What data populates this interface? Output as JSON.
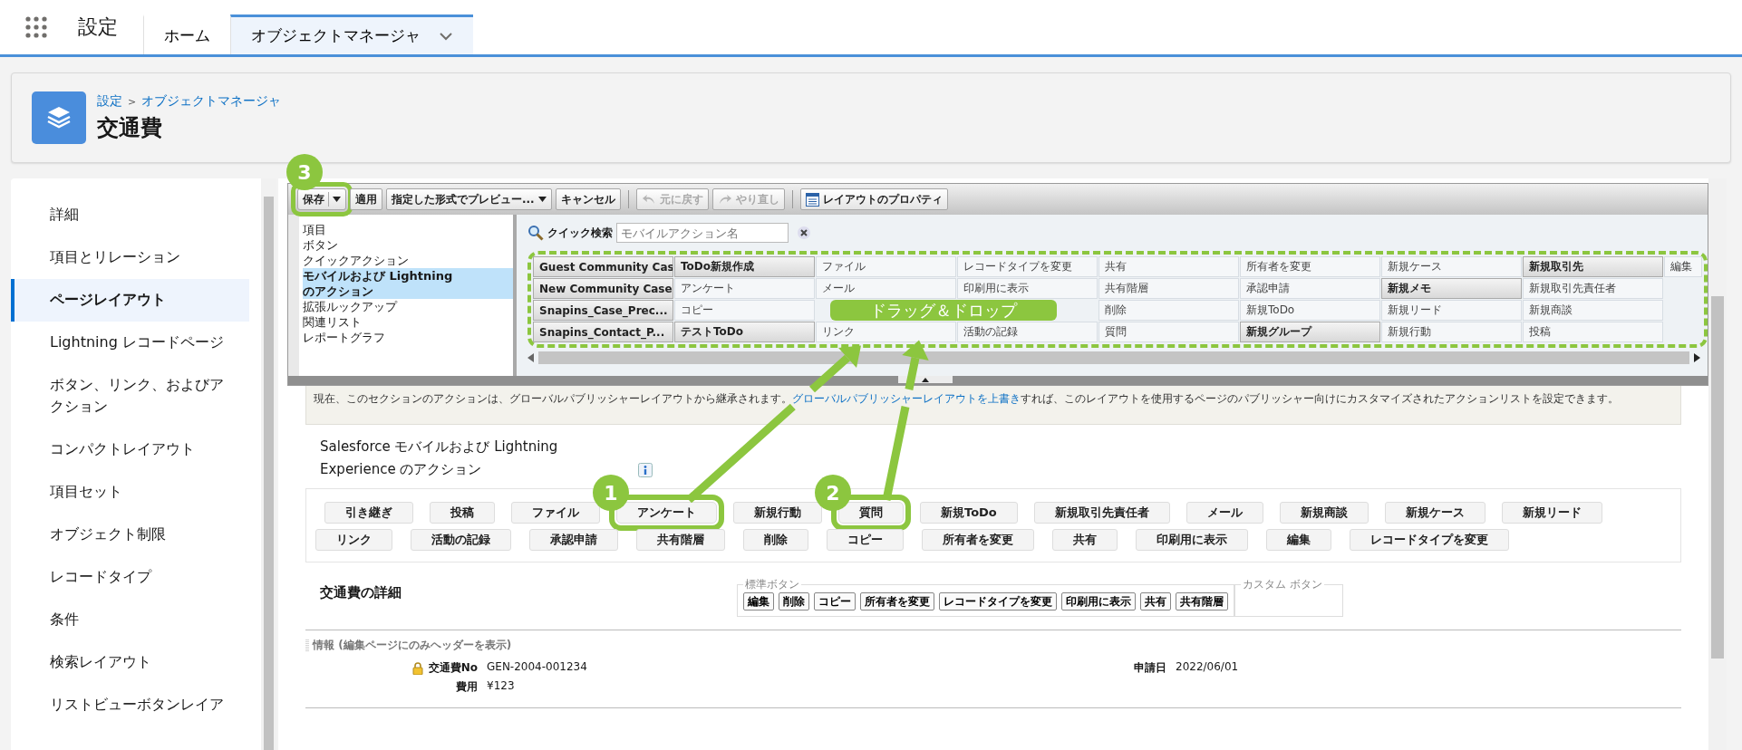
{
  "app_bar": {
    "title": "設定",
    "tabs": [
      {
        "label": "ホーム",
        "selected": false,
        "dropdown": false
      },
      {
        "label": "オブジェクトマネージャ",
        "selected": true,
        "dropdown": true
      }
    ]
  },
  "header": {
    "breadcrumb": [
      "設定",
      "オブジェクトマネージャ"
    ],
    "separator": ">",
    "title": "交通費"
  },
  "sidebar": {
    "items": [
      {
        "label": "詳細",
        "selected": false
      },
      {
        "label": "項目とリレーション",
        "selected": false
      },
      {
        "label": "ページレイアウト",
        "selected": true
      },
      {
        "label": "Lightning レコードページ",
        "selected": false
      },
      {
        "label": "ボタン、リンク、およびアクション",
        "selected": false
      },
      {
        "label": "コンパクトレイアウト",
        "selected": false
      },
      {
        "label": "項目セット",
        "selected": false
      },
      {
        "label": "オブジェクト制限",
        "selected": false
      },
      {
        "label": "レコードタイプ",
        "selected": false
      },
      {
        "label": "条件",
        "selected": false
      },
      {
        "label": "検索レイアウト",
        "selected": false
      },
      {
        "label": "リストビューボタンレイア",
        "selected": false
      }
    ]
  },
  "toolbar": {
    "groups": [
      {
        "buttons": [
          {
            "label": "保存",
            "kind": "split",
            "disabled": false,
            "callout": "3"
          },
          {
            "label": "適用",
            "kind": "plain",
            "disabled": false
          },
          {
            "label": "指定した形式でプレビュー...",
            "kind": "menu",
            "disabled": false
          },
          {
            "label": "キャンセル",
            "kind": "plain",
            "disabled": false
          }
        ]
      },
      {
        "buttons": [
          {
            "label": "元に戻す",
            "kind": "undo",
            "disabled": true
          },
          {
            "label": "やり直し",
            "kind": "redo",
            "disabled": true
          }
        ]
      },
      {
        "buttons": [
          {
            "label": "レイアウトのプロパティ",
            "kind": "properties",
            "disabled": false
          }
        ]
      }
    ]
  },
  "palette": {
    "categories": [
      {
        "label": "項目",
        "selected": false
      },
      {
        "label": "ボタン",
        "selected": false
      },
      {
        "label": "クイックアクション",
        "selected": false
      },
      {
        "label": "モバイルおよび Lightning のアクション",
        "selected": true
      },
      {
        "label": "拡張ルックアップ",
        "selected": false
      },
      {
        "label": "関連リスト",
        "selected": false
      },
      {
        "label": "レポートグラフ",
        "selected": false
      }
    ],
    "search": {
      "label": "クイック検索",
      "placeholder": "モバイルアクション名"
    },
    "grid": [
      [
        {
          "label": "Guest Community Cas",
          "highlighted": true
        },
        {
          "label": "ToDo新規作成",
          "highlighted": true
        },
        {
          "label": "ファイル",
          "highlighted": false
        },
        {
          "label": "レコードタイプを変更",
          "highlighted": false
        },
        {
          "label": "共有",
          "highlighted": false
        },
        {
          "label": "所有者を変更",
          "highlighted": false
        },
        {
          "label": "新規ケース",
          "highlighted": false
        },
        {
          "label": "新規取引先",
          "highlighted": true
        },
        {
          "label": "編集",
          "highlighted": false
        }
      ],
      [
        {
          "label": "New Community Case",
          "highlighted": true
        },
        {
          "label": "アンケート",
          "highlighted": false
        },
        {
          "label": "メール",
          "highlighted": false
        },
        {
          "label": "印刷用に表示",
          "highlighted": false
        },
        {
          "label": "共有階層",
          "highlighted": false
        },
        {
          "label": "承認申請",
          "highlighted": false
        },
        {
          "label": "新規メモ",
          "highlighted": true
        },
        {
          "label": "新規取引先責任者",
          "highlighted": false
        }
      ],
      [
        {
          "label": "Snapins_Case_Prec...",
          "highlighted": true
        },
        {
          "label": "コピー",
          "highlighted": false
        },
        {
          "kind": "covered"
        },
        {
          "kind": "covered"
        },
        {
          "label": "削除",
          "highlighted": false
        },
        {
          "label": "新規ToDo",
          "highlighted": false
        },
        {
          "label": "新規リード",
          "highlighted": false
        },
        {
          "label": "新規商談",
          "highlighted": false
        }
      ],
      [
        {
          "label": "Snapins_Contact_P...",
          "highlighted": true
        },
        {
          "label": "テストToDo",
          "highlighted": true
        },
        {
          "label": "リンク",
          "highlighted": false
        },
        {
          "label": "活動の記録",
          "highlighted": false
        },
        {
          "label": "質問",
          "highlighted": false
        },
        {
          "label": "新規グループ",
          "highlighted": true
        },
        {
          "label": "新規行動",
          "highlighted": false
        },
        {
          "label": "投稿",
          "highlighted": false
        }
      ]
    ],
    "drag_label": "ドラッグ＆ドロップ"
  },
  "notice": {
    "before": "現在、このセクションのアクションは、グローバルパブリッシャーレイアウトから継承されます。",
    "link": "グローバルパブリッシャーレイアウトを上書き",
    "after": "すれば、このレイアウトを使用するページのパブリッシャー向けにカスタマイズされたアクションリストを設定できます。"
  },
  "actions_section": {
    "title": "Salesforce モバイルおよび Lightning Experience のアクション",
    "rows": [
      [
        {
          "label": "引き継ぎ"
        },
        {
          "label": "投稿"
        },
        {
          "label": "ファイル"
        },
        {
          "label": "アンケート",
          "callout": "1"
        },
        {
          "label": "新規行動"
        },
        {
          "label": "質問",
          "callout": "2"
        },
        {
          "label": "新規ToDo"
        },
        {
          "label": "新規取引先責任者"
        },
        {
          "label": "メール"
        },
        {
          "label": "新規商談"
        },
        {
          "label": "新規ケース"
        },
        {
          "label": "新規リード"
        }
      ],
      [
        {
          "label": "リンク"
        },
        {
          "label": "活動の記録"
        },
        {
          "label": "承認申請"
        },
        {
          "label": "共有階層"
        },
        {
          "label": "削除"
        },
        {
          "label": "コピー"
        },
        {
          "label": "所有者を変更"
        },
        {
          "label": "共有"
        },
        {
          "label": "印刷用に表示"
        },
        {
          "label": "編集"
        },
        {
          "label": "レコードタイプを変更"
        }
      ]
    ]
  },
  "detail": {
    "title": "交通費の詳細",
    "standard_buttons": {
      "legend": "標準ボタン",
      "buttons": [
        "編集",
        "削除",
        "コピー",
        "所有者を変更",
        "レコードタイプを変更",
        "印刷用に表示",
        "共有",
        "共有階層"
      ]
    },
    "custom_buttons": {
      "legend": "カスタム ボタン"
    }
  },
  "info_section": {
    "title": "情報 (編集ページにのみヘッダーを表示)",
    "columns": [
      {
        "fields": [
          {
            "label": "交通費No",
            "value": "GEN-2004-001234",
            "locked": true
          },
          {
            "label": "費用",
            "value": "¥123",
            "locked": false
          }
        ]
      },
      {
        "fields": [
          {
            "label": "申請日",
            "value": "2022/06/01",
            "locked": false
          }
        ]
      }
    ]
  }
}
